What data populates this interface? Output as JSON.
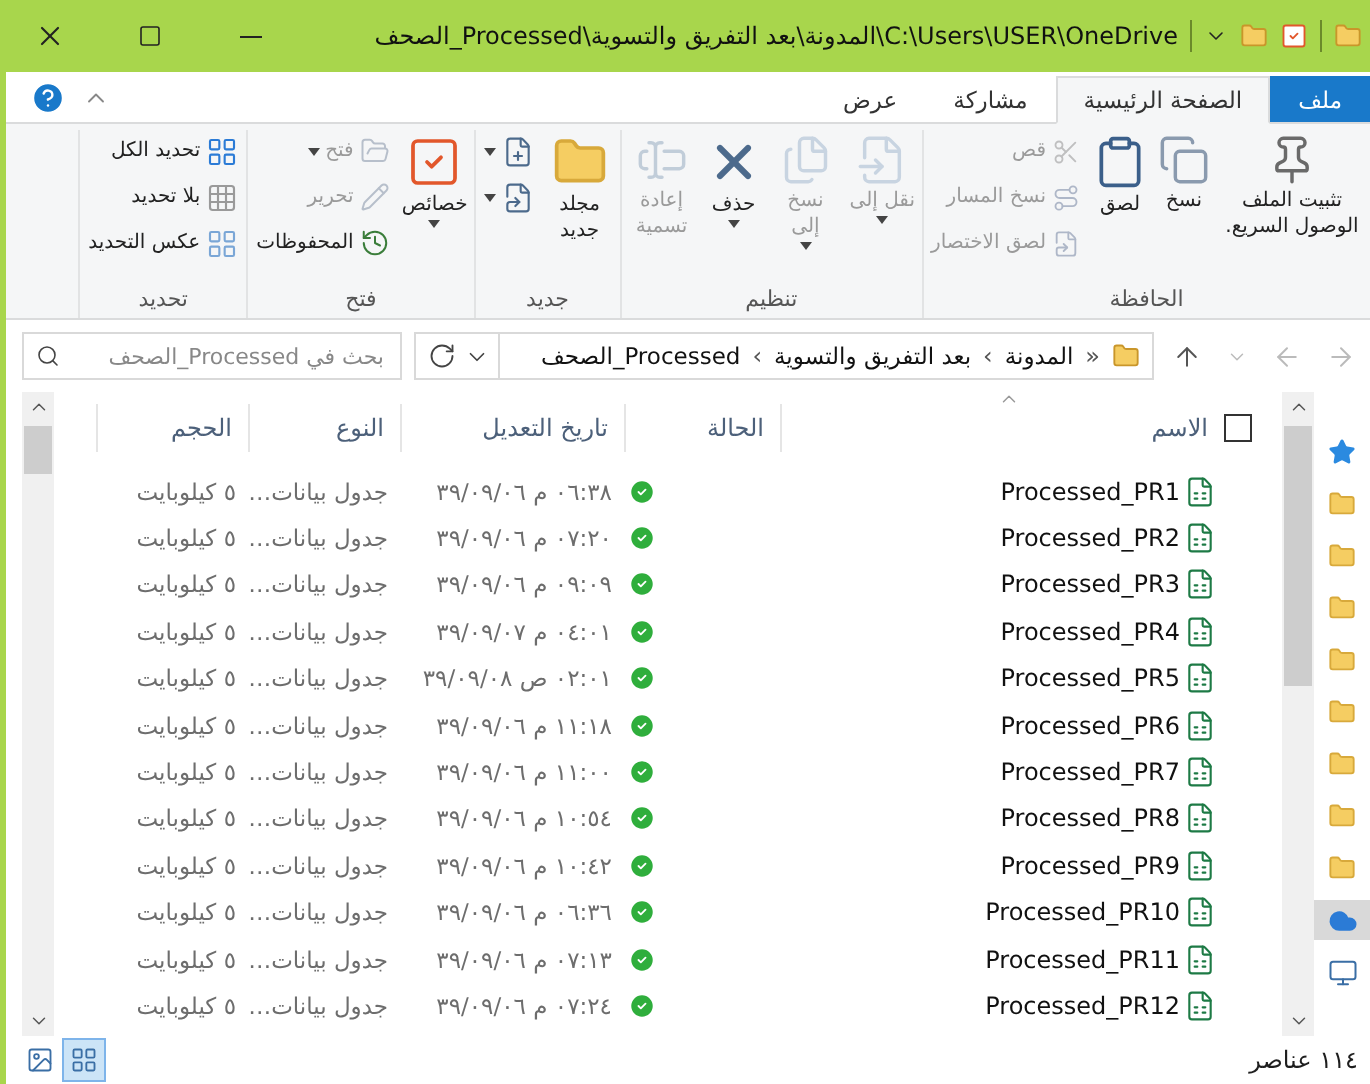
{
  "window": {
    "title": "C:\\Users\\USER\\OneDrive\\المدونة\\بعد التفريق والتسوية\\Processed_الصحف"
  },
  "ribbon_tabs": [
    {
      "label": "ملف",
      "kind": "file",
      "selected": false
    },
    {
      "label": "الصفحة الرئيسية",
      "kind": "tab",
      "selected": true
    },
    {
      "label": "مشاركة",
      "kind": "tab",
      "selected": false
    },
    {
      "label": "عرض",
      "kind": "tab",
      "selected": false
    }
  ],
  "ribbon_groups": [
    {
      "label": "الحافظة",
      "commands": [
        {
          "label": "تثبيت الملف الوصول السريع.",
          "kind": "wide",
          "disabled": false,
          "dropdown": false
        },
        {
          "label": "نسخ",
          "kind": "large",
          "disabled": false,
          "dropdown": false
        },
        {
          "label": "لصق",
          "kind": "large",
          "disabled": false,
          "dropdown": false
        },
        {
          "label": "قص",
          "kind": "small",
          "disabled": true,
          "dropdown": false
        },
        {
          "label": "نسخ المسار",
          "kind": "small",
          "disabled": true,
          "dropdown": false
        },
        {
          "label": "لصق الاختصار",
          "kind": "small",
          "disabled": true,
          "dropdown": false
        }
      ]
    },
    {
      "label": "تنظيم",
      "commands": [
        {
          "label": "نقل إلى",
          "kind": "large",
          "disabled": true,
          "dropdown": true
        },
        {
          "label": "نسخ إلى",
          "kind": "large",
          "disabled": true,
          "dropdown": true
        },
        {
          "label": "حذف",
          "kind": "large",
          "disabled": false,
          "dropdown": true
        },
        {
          "label": "إعادة تسمية",
          "kind": "large",
          "disabled": true,
          "dropdown": false
        }
      ]
    },
    {
      "label": "جديد",
      "commands": [
        {
          "label": "مجلد جديد",
          "kind": "large",
          "disabled": false,
          "dropdown": false
        },
        {
          "kind": "small",
          "disabled": false,
          "dropdown": true
        },
        {
          "kind": "small",
          "disabled": false,
          "dropdown": true
        }
      ]
    },
    {
      "label": "فتح",
      "commands": [
        {
          "label": "خصائص",
          "kind": "large",
          "disabled": false,
          "dropdown": true
        },
        {
          "label": "فتح",
          "kind": "small",
          "disabled": true,
          "dropdown": true
        },
        {
          "label": "تحرير",
          "kind": "small",
          "disabled": true,
          "dropdown": false
        },
        {
          "label": "المحفوظات",
          "kind": "small",
          "disabled": false,
          "dropdown": false
        }
      ]
    },
    {
      "label": "تحديد",
      "commands": [
        {
          "label": "تحديد الكل",
          "kind": "small",
          "disabled": false,
          "dropdown": false
        },
        {
          "label": "بلا تحديد",
          "kind": "small",
          "disabled": false,
          "dropdown": false
        },
        {
          "label": "عكس التحديد",
          "kind": "small",
          "disabled": false,
          "dropdown": false
        }
      ]
    }
  ],
  "address_bar": {
    "overflow": "«",
    "path": [
      "المدونة",
      "بعد التفريق والتسوية",
      "Processed_الصحف"
    ],
    "separator": "›"
  },
  "search": {
    "placeholder": "بحث في Processed_الصحف"
  },
  "columns": [
    "الاسم",
    "الحالة",
    "تاريخ التعديل",
    "النوع",
    "الحجم"
  ],
  "select_all": {
    "checked": false
  },
  "files": [
    {
      "name": "Processed_PR1",
      "kind": "available",
      "modified": "٠٦:٣٨ م ٣٩/٠٩/٠٦",
      "type": "جدول بيانات…",
      "size": "٥ كيلوبايت"
    },
    {
      "name": "Processed_PR2",
      "kind": "available",
      "modified": "٠٧:٢٠ م ٣٩/٠٩/٠٦",
      "type": "جدول بيانات…",
      "size": "٥ كيلوبايت"
    },
    {
      "name": "Processed_PR3",
      "kind": "available",
      "modified": "٠٩:٠٩ م ٣٩/٠٩/٠٦",
      "type": "جدول بيانات…",
      "size": "٥ كيلوبايت"
    },
    {
      "name": "Processed_PR4",
      "kind": "available",
      "modified": "٠٤:٠١ م ٣٩/٠٩/٠٧",
      "type": "جدول بيانات…",
      "size": "٥ كيلوبايت"
    },
    {
      "name": "Processed_PR5",
      "kind": "available",
      "modified": "٠٢:٠١ ص ٣٩/٠٩/٠٨",
      "type": "جدول بيانات…",
      "size": "٥ كيلوبايت"
    },
    {
      "name": "Processed_PR6",
      "kind": "available",
      "modified": "١١:١٨ م ٣٩/٠٩/٠٦",
      "type": "جدول بيانات…",
      "size": "٥ كيلوبايت"
    },
    {
      "name": "Processed_PR7",
      "kind": "available",
      "modified": "١١:٠٠ م ٣٩/٠٩/٠٦",
      "type": "جدول بيانات…",
      "size": "٥ كيلوبايت"
    },
    {
      "name": "Processed_PR8",
      "kind": "available",
      "modified": "١٠:٥٤ م ٣٩/٠٩/٠٦",
      "type": "جدول بيانات…",
      "size": "٥ كيلوبايت"
    },
    {
      "name": "Processed_PR9",
      "kind": "available",
      "modified": "١٠:٤٢ م ٣٩/٠٩/٠٦",
      "type": "جدول بيانات…",
      "size": "٥ كيلوبايت"
    },
    {
      "name": "Processed_PR10",
      "kind": "available",
      "modified": "٠٦:٣٦ م ٣٩/٠٩/٠٦",
      "type": "جدول بيانات…",
      "size": "٥ كيلوبايت"
    },
    {
      "name": "Processed_PR11",
      "kind": "available",
      "modified": "٠٧:١٣ م ٣٩/٠٩/٠٦",
      "type": "جدول بيانات…",
      "size": "٥ كيلوبايت"
    },
    {
      "name": "Processed_PR12",
      "kind": "available",
      "modified": "٠٧:٢٤ م ٣٩/٠٩/٠٦",
      "type": "جدول بيانات…",
      "size": "٥ كيلوبايت"
    }
  ],
  "navigation_pane": [
    {
      "kind": "quick_access",
      "selected": false
    },
    {
      "kind": "folder",
      "selected": false
    },
    {
      "kind": "folder",
      "selected": false
    },
    {
      "kind": "folder",
      "selected": false
    },
    {
      "kind": "folder",
      "selected": false
    },
    {
      "kind": "folder",
      "selected": false
    },
    {
      "kind": "folder",
      "selected": false
    },
    {
      "kind": "folder",
      "selected": false
    },
    {
      "kind": "folder",
      "selected": false
    },
    {
      "kind": "cloud",
      "selected": true
    },
    {
      "kind": "computer",
      "selected": false
    }
  ],
  "status_bar": {
    "item_count": "١١٤ عناصر",
    "views": [
      {
        "kind": "details",
        "selected": true
      },
      {
        "kind": "large_icons",
        "selected": false
      }
    ]
  }
}
